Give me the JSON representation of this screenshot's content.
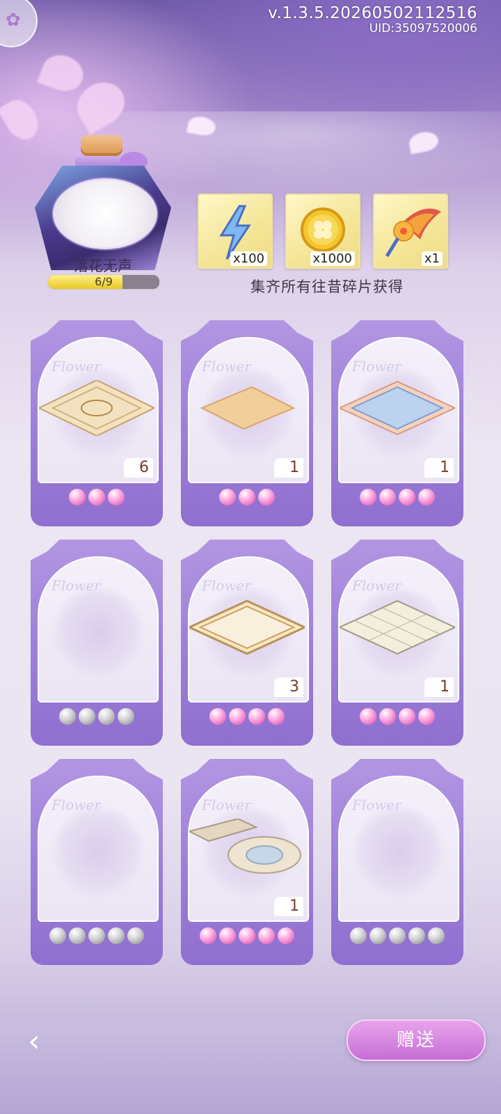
{
  "header": {
    "version": "v.1.3.5.20260502112516",
    "uid": "UID:35097520006"
  },
  "collection": {
    "name": "落花无声",
    "progress_text": "6/9",
    "progress_fraction": 0.667
  },
  "rewards": {
    "items": [
      {
        "icon": "lightning-icon",
        "count": "x100"
      },
      {
        "icon": "clover-coin-icon",
        "count": "x1000"
      },
      {
        "icon": "flower-brush-icon",
        "count": "x1"
      }
    ],
    "caption": "集齐所有往昔碎片获得"
  },
  "cards": [
    {
      "owned": true,
      "count": "6",
      "stars": 3,
      "rug": "ornate-rug"
    },
    {
      "owned": true,
      "count": "1",
      "stars": 3,
      "rug": "plain-rug"
    },
    {
      "owned": true,
      "count": "1",
      "stars": 4,
      "rug": "blue-tile-rug"
    },
    {
      "owned": false,
      "count": "",
      "stars": 4,
      "rug": ""
    },
    {
      "owned": true,
      "count": "3",
      "stars": 4,
      "rug": "border-rug"
    },
    {
      "owned": true,
      "count": "1",
      "stars": 4,
      "rug": "grid-rug"
    },
    {
      "owned": false,
      "count": "",
      "stars": 5,
      "rug": ""
    },
    {
      "owned": true,
      "count": "1",
      "stars": 5,
      "rug": "mosaic-floor"
    },
    {
      "owned": false,
      "count": "",
      "stars": 5,
      "rug": ""
    }
  ],
  "card_watermark": "Flower",
  "footer": {
    "gift_label": "赠送",
    "back_icon": "back-arrow-icon"
  }
}
